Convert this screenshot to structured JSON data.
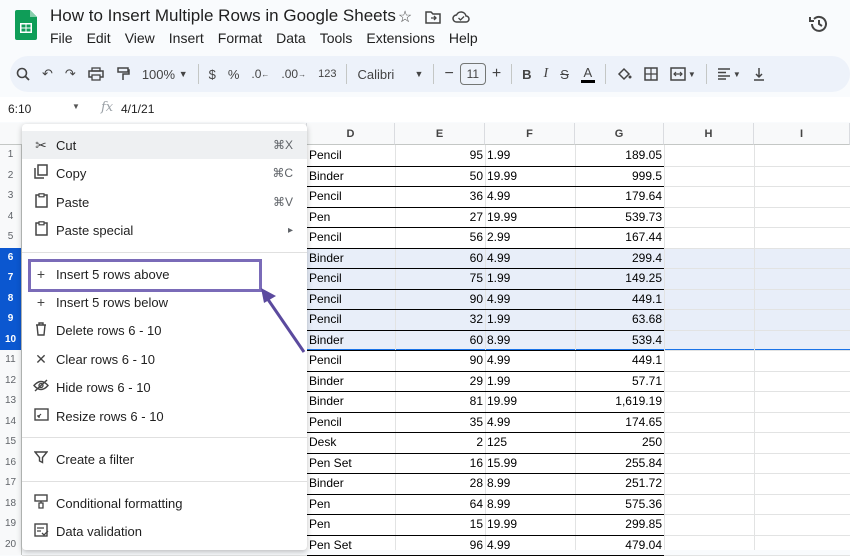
{
  "app": {
    "doc_title": "How to Insert Multiple Rows in Google Sheets",
    "menu": [
      "File",
      "Edit",
      "View",
      "Insert",
      "Format",
      "Data",
      "Tools",
      "Extensions",
      "Help"
    ],
    "icons": {
      "star": "star-icon",
      "folder": "move-folder-icon",
      "cloud": "cloud-status-icon",
      "history": "history-icon"
    }
  },
  "toolbar": {
    "zoom": "100%",
    "currency": "$",
    "percent": "%",
    "dec_decrease": ".0",
    "dec_increase": ".00",
    "number_format": "123",
    "font": "Calibri",
    "font_size": "11",
    "bold": "B",
    "italic": "I",
    "strike": "S",
    "text_color": "A",
    "minus": "−",
    "plus": "+"
  },
  "formula_bar": {
    "name_box": "6:10",
    "fx": "fx",
    "value": "4/1/21"
  },
  "grid": {
    "columns": [
      "D",
      "E",
      "F",
      "G",
      "H",
      "I"
    ],
    "rows": [
      {
        "n": "1",
        "d": "Pencil",
        "e": "95",
        "f": "1.99",
        "g": "189.05"
      },
      {
        "n": "2",
        "d": "Binder",
        "e": "50",
        "f": "19.99",
        "g": "999.5"
      },
      {
        "n": "3",
        "d": "Pencil",
        "e": "36",
        "f": "4.99",
        "g": "179.64"
      },
      {
        "n": "4",
        "d": "Pen",
        "e": "27",
        "f": "19.99",
        "g": "539.73"
      },
      {
        "n": "5",
        "d": "Pencil",
        "e": "56",
        "f": "2.99",
        "g": "167.44"
      },
      {
        "n": "6",
        "d": "Binder",
        "e": "60",
        "f": "4.99",
        "g": "299.4"
      },
      {
        "n": "7",
        "d": "Pencil",
        "e": "75",
        "f": "1.99",
        "g": "149.25"
      },
      {
        "n": "8",
        "d": "Pencil",
        "e": "90",
        "f": "4.99",
        "g": "449.1"
      },
      {
        "n": "9",
        "d": "Pencil",
        "e": "32",
        "f": "1.99",
        "g": "63.68"
      },
      {
        "n": "10",
        "d": "Binder",
        "e": "60",
        "f": "8.99",
        "g": "539.4"
      },
      {
        "n": "11",
        "d": "Pencil",
        "e": "90",
        "f": "4.99",
        "g": "449.1"
      },
      {
        "n": "12",
        "d": "Binder",
        "e": "29",
        "f": "1.99",
        "g": "57.71"
      },
      {
        "n": "13",
        "d": "Binder",
        "e": "81",
        "f": "19.99",
        "g": "1,619.19"
      },
      {
        "n": "14",
        "d": "Pencil",
        "e": "35",
        "f": "4.99",
        "g": "174.65"
      },
      {
        "n": "15",
        "d": "Desk",
        "e": "2",
        "f": "125",
        "g": "250"
      },
      {
        "n": "16",
        "d": "Pen Set",
        "e": "16",
        "f": "15.99",
        "g": "255.84"
      },
      {
        "n": "17",
        "d": "Binder",
        "e": "28",
        "f": "8.99",
        "g": "251.72"
      },
      {
        "n": "18",
        "d": "Pen",
        "e": "64",
        "f": "8.99",
        "g": "575.36"
      },
      {
        "n": "19",
        "d": "Pen",
        "e": "15",
        "f": "19.99",
        "g": "299.85"
      },
      {
        "n": "20",
        "d": "Pen Set",
        "e": "96",
        "f": "4.99",
        "g": "479.04"
      }
    ],
    "selected_rows": [
      "6",
      "7",
      "8",
      "9",
      "10"
    ]
  },
  "context_menu": {
    "items": [
      {
        "icon": "scissors-icon",
        "label": "Cut",
        "shortcut": "⌘X"
      },
      {
        "icon": "copy-icon",
        "label": "Copy",
        "shortcut": "⌘C"
      },
      {
        "icon": "clipboard-icon",
        "label": "Paste",
        "shortcut": "⌘V"
      },
      {
        "icon": "clipboard-icon",
        "label": "Paste special",
        "shortcut": "▸"
      },
      {
        "icon": "plus-icon",
        "label": "Insert 5 rows above",
        "shortcut": ""
      },
      {
        "icon": "plus-icon",
        "label": "Insert 5 rows below",
        "shortcut": ""
      },
      {
        "icon": "trash-icon",
        "label": "Delete rows 6 - 10",
        "shortcut": ""
      },
      {
        "icon": "close-icon",
        "label": "Clear rows 6 - 10",
        "shortcut": ""
      },
      {
        "icon": "eye-off-icon",
        "label": "Hide rows 6 - 10",
        "shortcut": ""
      },
      {
        "icon": "resize-icon",
        "label": "Resize rows 6 - 10",
        "shortcut": ""
      },
      {
        "icon": "filter-icon",
        "label": "Create a filter",
        "shortcut": ""
      },
      {
        "icon": "palette-icon",
        "label": "Conditional formatting",
        "shortcut": ""
      },
      {
        "icon": "data-validation-icon",
        "label": "Data validation",
        "shortcut": ""
      }
    ]
  },
  "colors": {
    "selection": "#0b57d0",
    "highlight_box": "#7a6bb8",
    "sheets_green": "#0f9d58"
  }
}
